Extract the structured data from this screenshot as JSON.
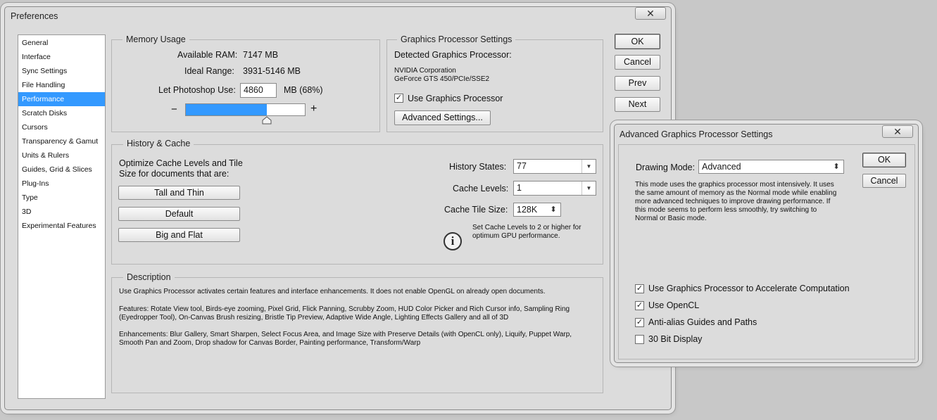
{
  "preferences": {
    "title": "Preferences",
    "close_glyph": "✕",
    "categories": [
      {
        "label": "General"
      },
      {
        "label": "Interface"
      },
      {
        "label": "Sync Settings"
      },
      {
        "label": "File Handling"
      },
      {
        "label": "Performance",
        "selected": true
      },
      {
        "label": "Scratch Disks"
      },
      {
        "label": "Cursors"
      },
      {
        "label": "Transparency & Gamut"
      },
      {
        "label": "Units & Rulers"
      },
      {
        "label": "Guides, Grid & Slices"
      },
      {
        "label": "Plug-Ins"
      },
      {
        "label": "Type"
      },
      {
        "label": "3D"
      },
      {
        "label": "Experimental Features"
      }
    ],
    "memory": {
      "legend": "Memory Usage",
      "available_label": "Available RAM:",
      "available_value": "7147 MB",
      "ideal_label": "Ideal Range:",
      "ideal_value": "3931-5146 MB",
      "let_use_label": "Let Photoshop Use:",
      "let_use_value": "4860",
      "let_use_suffix": "MB (68%)",
      "minus": "−",
      "plus": "+",
      "slider_fraction": 0.68
    },
    "gpu": {
      "legend": "Graphics Processor Settings",
      "detected_label": "Detected Graphics Processor:",
      "vendor": "NVIDIA Corporation",
      "model": "GeForce GTS 450/PCIe/SSE2",
      "use_gpu_label": "Use Graphics Processor",
      "use_gpu_checked": true,
      "advanced_button": "Advanced Settings..."
    },
    "history": {
      "legend": "History & Cache",
      "optimize_line1": "Optimize Cache Levels and Tile",
      "optimize_line2": "Size for documents that are:",
      "buttons": [
        "Tall and Thin",
        "Default",
        "Big and Flat"
      ],
      "history_states_label": "History States:",
      "history_states_value": "77",
      "cache_levels_label": "Cache Levels:",
      "cache_levels_value": "1",
      "tile_size_label": "Cache Tile Size:",
      "tile_size_value": "128K",
      "hint_line1": "Set Cache Levels to 2 or higher for",
      "hint_line2": "optimum GPU performance.",
      "info_glyph": "i"
    },
    "description": {
      "legend": "Description",
      "p1": "Use Graphics Processor activates certain features and interface enhancements. It does not enable OpenGL on already open documents.",
      "p2a": "Features: Rotate View tool, Birds-eye zooming, Pixel Grid, Flick Panning, Scrubby Zoom, HUD Color Picker and Rich Cursor info, Sampling Ring",
      "p2b": "(Eyedropper Tool), On-Canvas Brush resizing, Bristle Tip Preview, Adaptive Wide Angle, Lighting Effects Gallery and all of 3D",
      "p3a": "Enhancements: Blur Gallery, Smart Sharpen, Select Focus Area, and Image Size with Preserve Details (with OpenCL only), Liquify, Puppet Warp,",
      "p3b": "Smooth Pan and Zoom, Drop shadow for Canvas Border, Painting performance, Transform/Warp"
    },
    "buttons": {
      "ok": "OK",
      "cancel": "Cancel",
      "prev": "Prev",
      "next": "Next"
    }
  },
  "advanced_dialog": {
    "title": "Advanced Graphics Processor Settings",
    "close_glyph": "✕",
    "drawing_mode_label": "Drawing Mode:",
    "drawing_mode_value": "Advanced",
    "mode_desc": [
      "This mode uses the graphics processor most intensively.  It uses",
      "the same amount of memory as the Normal mode while enabling",
      "more advanced techniques to improve drawing performance.  If",
      "this mode seems to perform less smoothly, try switching to",
      "Normal or Basic mode."
    ],
    "options": [
      {
        "label": "Use Graphics Processor to Accelerate Computation",
        "checked": true
      },
      {
        "label": "Use OpenCL",
        "checked": true
      },
      {
        "label": "Anti-alias Guides and Paths",
        "checked": true
      },
      {
        "label": "30 Bit Display",
        "checked": false
      }
    ],
    "ok": "OK",
    "cancel": "Cancel"
  },
  "glyphs": {
    "check": "✓",
    "combo_arrow": "▼",
    "spin_arrows": "⬍"
  }
}
